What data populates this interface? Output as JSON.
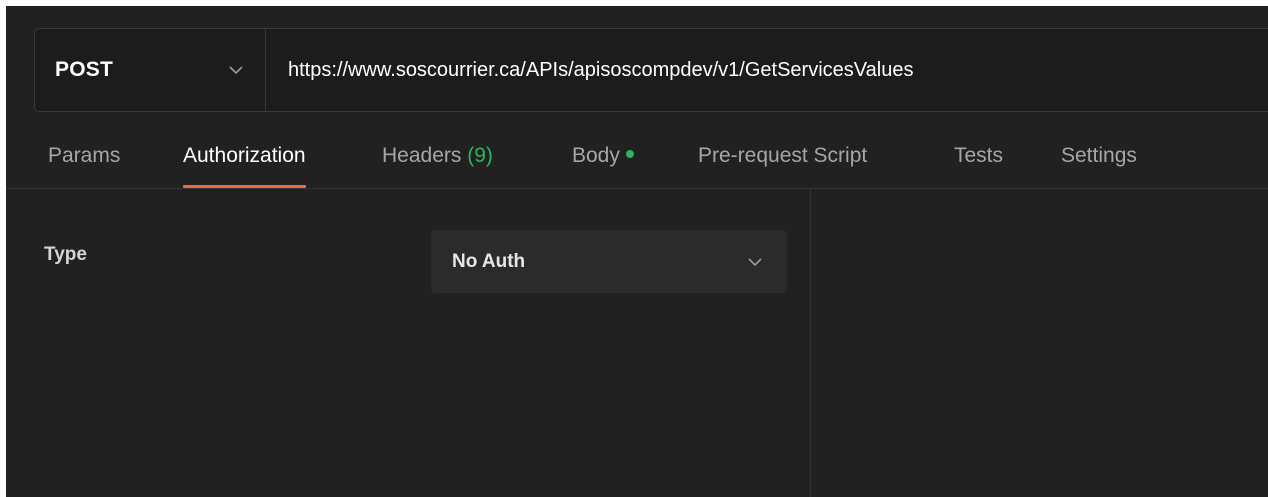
{
  "request": {
    "method": "POST",
    "url": "https://www.soscourrier.ca/APIs/apisoscompdev/v1/GetServicesValues"
  },
  "tabs": [
    {
      "label": "Params",
      "active": false
    },
    {
      "label": "Authorization",
      "active": true
    },
    {
      "label": "Headers",
      "count": "(9)",
      "active": false
    },
    {
      "label": "Body",
      "active": false,
      "indicator": "green-dot"
    },
    {
      "label": "Pre-request Script",
      "active": false
    },
    {
      "label": "Tests",
      "active": false
    },
    {
      "label": "Settings",
      "active": false
    }
  ],
  "authorization": {
    "type_label": "Type",
    "selected_type": "No Auth"
  },
  "colors": {
    "background": "#212121",
    "accent": "#f26b3a",
    "success": "#2bb55e"
  },
  "icons": {
    "method_dropdown": "chevron-down-icon",
    "auth_dropdown": "chevron-down-icon",
    "body_indicator": "dot-icon"
  }
}
